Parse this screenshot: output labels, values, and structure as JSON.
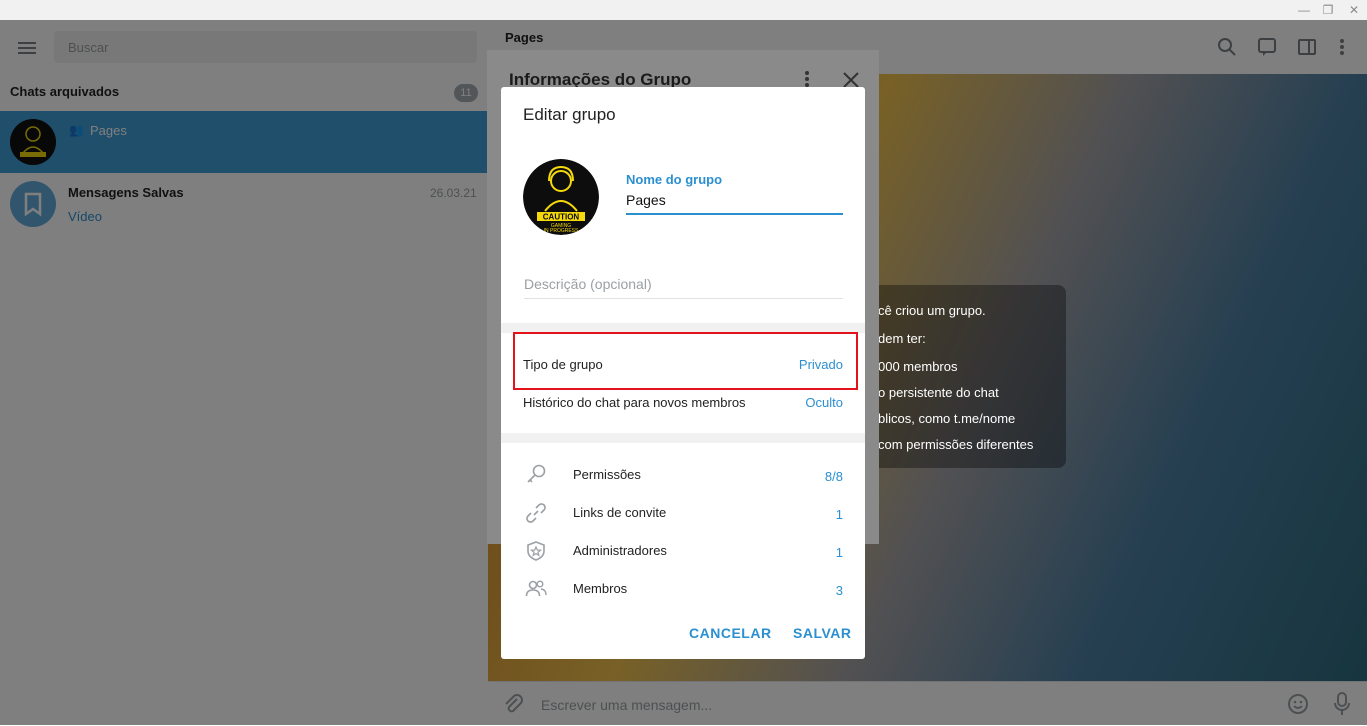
{
  "left": {
    "search_placeholder": "Buscar",
    "archived_title": "Chats arquivados",
    "archived_count": "11",
    "chats": [
      {
        "name": "Pages",
        "preview": "",
        "date": ""
      },
      {
        "name": "Mensagens Salvas",
        "preview": "Vídeo",
        "date": "26.03.21"
      }
    ]
  },
  "chat": {
    "title": "Pages",
    "composer_placeholder": "Escrever uma mensagem...",
    "service_lines": [
      "cê criou um grupo.",
      "dem ter:",
      "000 membros",
      "o persistente do chat",
      "blicos, como t.me/nome",
      "com permissões diferentes"
    ]
  },
  "info_panel": {
    "title": "Informações do Grupo"
  },
  "dialog": {
    "title": "Editar grupo",
    "avatar_text": [
      "CAUTION",
      "GAMING",
      "IN PROGRESS"
    ],
    "name_label": "Nome do grupo",
    "name_value": "Pages",
    "description_placeholder": "Descrição (opcional)",
    "settings": [
      {
        "label": "Tipo de grupo",
        "value": "Privado"
      },
      {
        "label": "Histórico do chat para novos membros",
        "value": "Oculto"
      }
    ],
    "manage": [
      {
        "icon": "key-icon",
        "label": "Permissões",
        "value": "8/8"
      },
      {
        "icon": "link-icon",
        "label": "Links de convite",
        "value": "1"
      },
      {
        "icon": "shield-star-icon",
        "label": "Administradores",
        "value": "1"
      },
      {
        "icon": "members-icon",
        "label": "Membros",
        "value": "3"
      }
    ],
    "cancel_label": "CANCELAR",
    "save_label": "SALVAR"
  },
  "colors": {
    "accent": "#2b8fd0",
    "selection": "#419fd9",
    "highlight": "#e3121b"
  }
}
